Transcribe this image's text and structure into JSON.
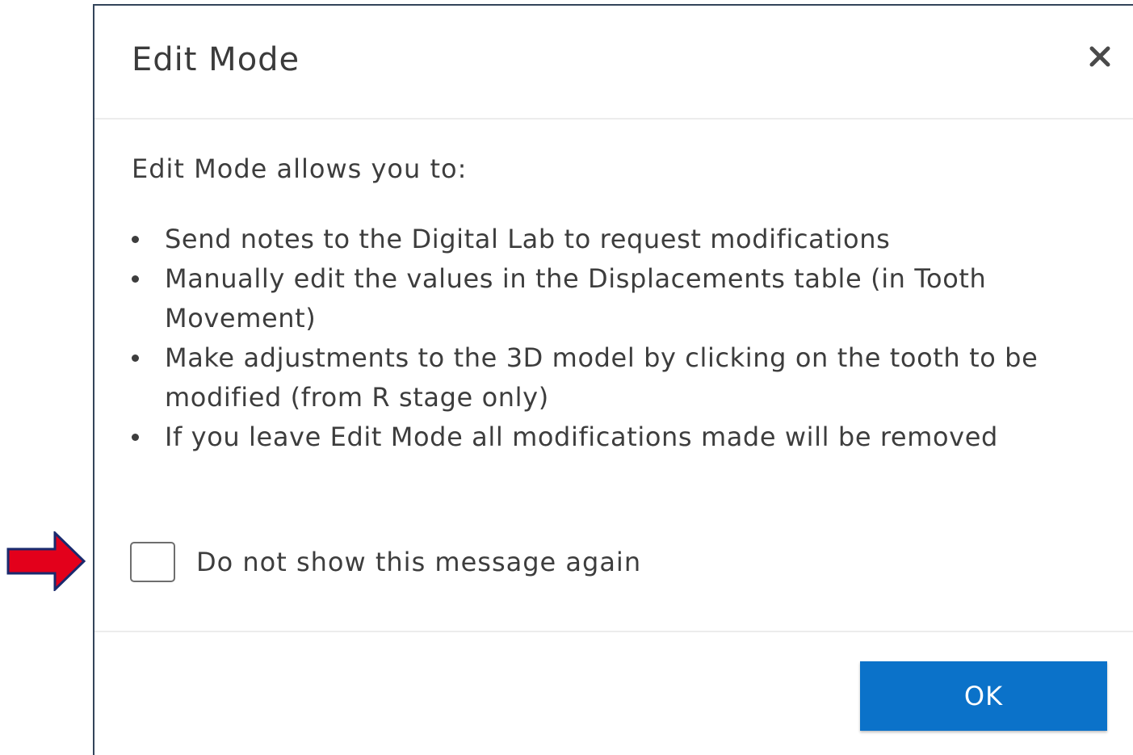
{
  "dialog": {
    "title": "Edit Mode",
    "close_icon": "close-icon",
    "intro": "Edit Mode allows you to:",
    "items": [
      "Send notes to the Digital Lab to request modifications",
      "Manually edit the values in the Displacements table (in Tooth Movement)",
      "Make adjustments to the 3D model by clicking on the tooth to be modified (from R stage only)",
      "If you leave Edit Mode all modifications made will be removed"
    ],
    "checkbox": {
      "label": "Do not show this message again",
      "checked": false
    },
    "ok_label": "OK"
  },
  "annotation": {
    "arrow_icon": "arrow-right-icon",
    "arrow_color": "#e3001b"
  },
  "colors": {
    "primary_button": "#0b72c9",
    "text": "#3d3d3d",
    "divider": "#ececec"
  }
}
